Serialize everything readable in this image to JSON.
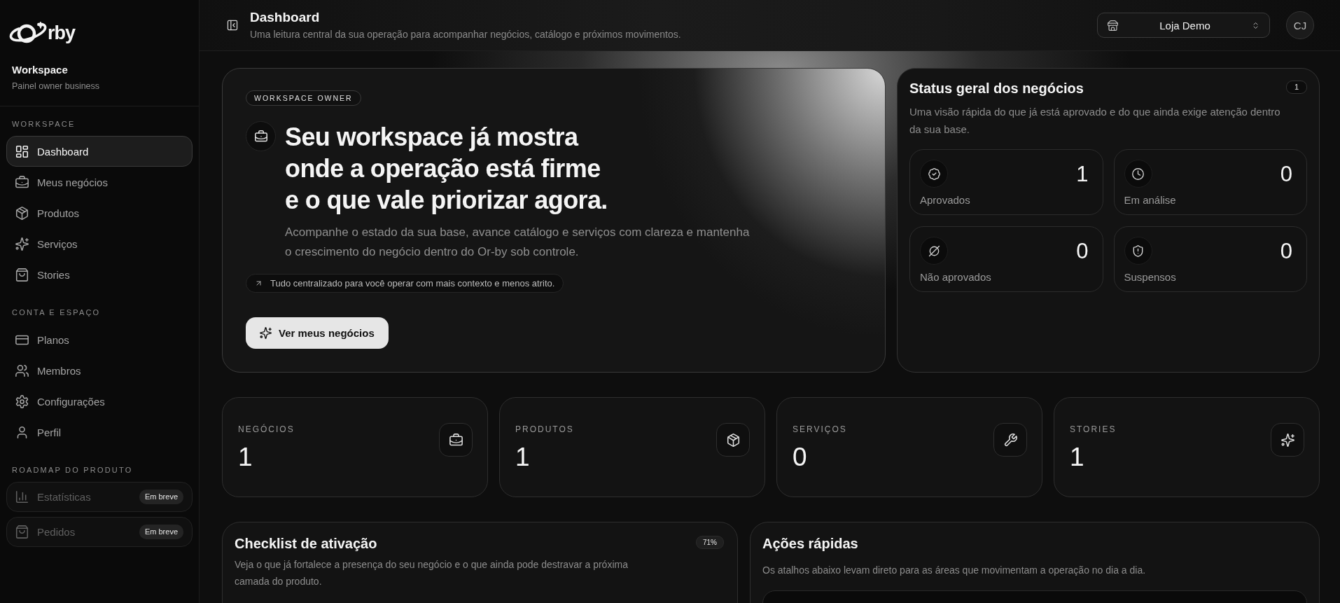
{
  "sidebar": {
    "logo": {
      "text": "rby"
    },
    "workspace": {
      "title": "Workspace",
      "subtitle": "Painel owner business"
    },
    "sections": [
      {
        "title": "WORKSPACE",
        "items": [
          {
            "label": "Dashboard",
            "selected": true
          },
          {
            "label": "Meus negócios",
            "selected": false
          },
          {
            "label": "Produtos",
            "selected": false
          },
          {
            "label": "Serviços",
            "selected": false
          },
          {
            "label": "Stories",
            "selected": false
          }
        ]
      },
      {
        "title": "CONTA E ESPAÇO",
        "items": [
          {
            "label": "Planos",
            "selected": false
          },
          {
            "label": "Membros",
            "selected": false
          },
          {
            "label": "Configurações",
            "selected": false
          },
          {
            "label": "Perfil",
            "selected": false
          }
        ]
      },
      {
        "title": "ROADMAP DO PRODUTO",
        "items": [
          {
            "label": "Estatísticas",
            "selected": false,
            "disabled": true,
            "badge": "Em breve"
          },
          {
            "label": "Pedidos",
            "selected": false,
            "disabled": true,
            "badge": "Em breve"
          }
        ]
      }
    ]
  },
  "header": {
    "title": "Dashboard",
    "subtitle": "Uma leitura central da sua operação para acompanhar negócios, catálogo e próximos movimentos.",
    "store_selector": {
      "value": "Loja Demo"
    },
    "avatar": {
      "initials": "CJ"
    }
  },
  "hero": {
    "badge": "WORKSPACE OWNER",
    "headline": "Seu workspace já mostra onde a operação está firme e o que vale priorizar agora.",
    "description": "Acompanhe o estado da sua base, avance catálogo e serviços com clareza e mantenha o crescimento do negócio dentro do Or-by sob controle.",
    "note": "Tudo centralizado para você operar com mais contexto e menos atrito.",
    "button": "Ver meus negócios"
  },
  "status_panel": {
    "title": "Status geral dos negócios",
    "count": "1",
    "description": "Uma visão rápida do que já está aprovado e do que ainda exige atenção dentro da sua base.",
    "items": [
      {
        "label": "Aprovados",
        "value": "1"
      },
      {
        "label": "Em análise",
        "value": "0"
      },
      {
        "label": "Não aprovados",
        "value": "0"
      },
      {
        "label": "Suspensos",
        "value": "0"
      }
    ]
  },
  "stat_cards": [
    {
      "label": "NEGÓCIOS",
      "value": "1"
    },
    {
      "label": "PRODUTOS",
      "value": "1"
    },
    {
      "label": "SERVIÇOS",
      "value": "0"
    },
    {
      "label": "STORIES",
      "value": "1"
    }
  ],
  "checklist": {
    "title": "Checklist de ativação",
    "progress": "71%",
    "description": "Veja o que já fortalece a presença do seu negócio e o que ainda pode destravar a próxima camada do produto."
  },
  "quick_actions": {
    "title": "Ações rápidas",
    "description": "Os atalhos abaixo levam direto para as áreas que movimentam a operação no dia a dia."
  }
}
